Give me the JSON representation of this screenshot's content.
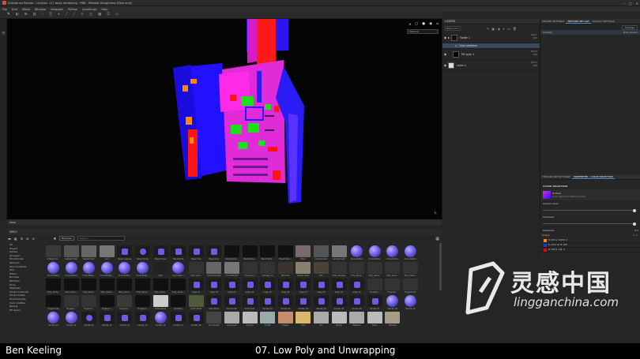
{
  "window": {
    "title": "Substance Painter - License: 117 days remaining - PBR - Metallic Roughness (Real only)",
    "controls": [
      "–",
      "□",
      "×"
    ]
  },
  "menu": [
    "File",
    "Edit",
    "Mode",
    "Window",
    "Viewport",
    "Python",
    "JavaScript",
    "Help"
  ],
  "toolbar": {
    "icons": [
      "paint-icon",
      "eraser-icon",
      "projection-icon",
      "polygon-fill-icon",
      "smudge-icon",
      "clone-icon",
      "picker-icon",
      "brush-icon",
      "line-icon",
      "stamp-icon",
      "mirror-icon",
      "grid-icon",
      "lock-icon",
      "link-icon"
    ]
  },
  "viewport": {
    "mode_dropdown": "Material",
    "controls": [
      "⏸",
      "▢",
      "●",
      "◉",
      "⌂"
    ]
  },
  "layers": {
    "tab_label": "LAYERS",
    "blend_label": "Base Color",
    "items": [
      {
        "name": "Folder 1",
        "blend": "Norm",
        "opacity": "100",
        "type": "folder"
      },
      {
        "name": "Color selection",
        "blend": "",
        "opacity": "",
        "type": "mask"
      },
      {
        "name": "Fill layer 1",
        "blend": "Norm",
        "opacity": "100",
        "type": "fill"
      },
      {
        "name": "Layer 1",
        "blend": "Norm",
        "opacity": "100",
        "type": "paint"
      }
    ]
  },
  "right_panel": {
    "tabs": [
      "SHADER SETTINGS",
      "TEXTURE SET LIST",
      "DISPLAY SETTINGS"
    ],
    "settings_label": "Settings",
    "texture_set": "Console",
    "texture_set_shader": "Main shader",
    "props_tabs": [
      "TEXTURE SET SETTINGS",
      "PROPERTIES - COLOR SELECTION"
    ],
    "section": "COLOR SELECTION",
    "source_title": "ID Mask",
    "source_sub": "Color Map from Mesh Console",
    "output_label": "Output value",
    "hardness_label": "Hardness",
    "tolerance_label": "Tolerance",
    "tolerance_value": "0.1",
    "colors_label": "Colors",
    "colors": [
      {
        "text": "R: 255   G: 138   B: 0",
        "hex": "#ff8a00"
      },
      {
        "text": "R: 24    G: 61    B: 220",
        "hex": "#183ddc"
      },
      {
        "text": "R: 255   G: 0     B: 0",
        "hex": "#ff0000"
      }
    ]
  },
  "bottom_tab": "POSE",
  "shelf": {
    "title": "SHELF",
    "filter": "Textures",
    "search_placeholder": "Search...",
    "categories": [
      "All",
      "Project",
      "Alphas",
      "Grunges",
      "Procedurals",
      "Textures",
      "Hard Surfaces",
      "Skin",
      "Filters",
      "Brushes",
      "Particles",
      "Tools",
      "Materials",
      "Smart materials",
      "Smart masks",
      "Environments",
      "Color profiles",
      "Baking",
      "Fill layers"
    ],
    "tiles": [
      {
        "label": "Ambient Oc...",
        "kind": "noise"
      },
      {
        "label": "Asphalt Fresh",
        "kind": "asphalt"
      },
      {
        "label": "Asphalt Worn",
        "kind": "asphalt2"
      },
      {
        "label": "Soil",
        "kind": "soil"
      },
      {
        "label": "Bevel Capsule",
        "kind": "capsule"
      },
      {
        "label": "Bevel Circle",
        "kind": "ring"
      },
      {
        "label": "Bevel Cross",
        "kind": "cross"
      },
      {
        "label": "Bevel Drop",
        "kind": "drop"
      },
      {
        "label": "Bevel Hex",
        "kind": "hex"
      },
      {
        "label": "Bevel Line",
        "kind": "line"
      },
      {
        "label": "Bevel Perla...",
        "kind": "dark"
      },
      {
        "label": "Bevel Perla...",
        "kind": "dark"
      },
      {
        "label": "Bevel Perla...",
        "kind": "dark"
      },
      {
        "label": "Bevel Perla...",
        "kind": "dark"
      },
      {
        "label": "Brick",
        "kind": "brick"
      },
      {
        "label": "Cement Dark",
        "kind": "cement"
      },
      {
        "label": "Cement Light",
        "kind": "cement2"
      },
      {
        "label": "Circle Button",
        "kind": "sphere"
      },
      {
        "label": "Circle Button",
        "kind": "sphere"
      },
      {
        "label": "Circle Button",
        "kind": "sphere"
      },
      {
        "label": "Circle Button",
        "kind": "sphere"
      },
      {
        "label": "Circle Button",
        "kind": "sphere"
      },
      {
        "label": "Circle Button",
        "kind": "sphere"
      },
      {
        "label": "Circle Butto...",
        "kind": "sphere"
      },
      {
        "label": "Circle Butto...",
        "kind": "sphere"
      },
      {
        "label": "Circle Butto...",
        "kind": "sphere"
      },
      {
        "label": "Circle Butto...",
        "kind": "sphere"
      },
      {
        "label": "Coal",
        "kind": "coal"
      },
      {
        "label": "Color Map 1",
        "kind": "sphere"
      },
      {
        "label": "Color_sam...",
        "kind": "gradient"
      },
      {
        "label": "Concrete Cast",
        "kind": "concrete"
      },
      {
        "label": "Concrete Old",
        "kind": "concrete2"
      },
      {
        "label": "Corrosion 1",
        "kind": "rough"
      },
      {
        "label": "damage_1a",
        "kind": "rough"
      },
      {
        "label": "Dark Soil",
        "kind": "soil2"
      },
      {
        "label": "Desert Sand",
        "kind": "sand"
      },
      {
        "label": "Dirt",
        "kind": "dirt"
      },
      {
        "label": "dirty_damage",
        "kind": "rough"
      },
      {
        "label": "dirty_dama...",
        "kind": "rough"
      },
      {
        "label": "dirty_dama...",
        "kind": "rough"
      },
      {
        "label": "dirty_dama...",
        "kind": "rough"
      },
      {
        "label": "dirty_dama...",
        "kind": "rough"
      },
      {
        "label": "dirty_dama...",
        "kind": "dark"
      },
      {
        "label": "dirty_dama...",
        "kind": "dark"
      },
      {
        "label": "dirty_dama...",
        "kind": "dark"
      },
      {
        "label": "dirty_dama...",
        "kind": "dark"
      },
      {
        "label": "dirty_dama...",
        "kind": "dark"
      },
      {
        "label": "dirty_dama...",
        "kind": "dark"
      },
      {
        "label": "dirty_dama...",
        "kind": "dark"
      },
      {
        "label": "dirty_dama...",
        "kind": "dark"
      },
      {
        "label": "edge_01",
        "kind": "cap"
      },
      {
        "label": "edge_02",
        "kind": "cap"
      },
      {
        "label": "edge_03",
        "kind": "cap"
      },
      {
        "label": "edge_04",
        "kind": "cap"
      },
      {
        "label": "edge_05",
        "kind": "cap"
      },
      {
        "label": "edge_06",
        "kind": "cap"
      },
      {
        "label": "edge_07",
        "kind": "cap"
      },
      {
        "label": "edge_08",
        "kind": "cap"
      },
      {
        "label": "edge_09",
        "kind": "cap"
      },
      {
        "label": "edge_10",
        "kind": "cap"
      },
      {
        "label": "Fingerpri...",
        "kind": "rough"
      },
      {
        "label": "Fingerpri...",
        "kind": "rough"
      },
      {
        "label": "Fingerprints",
        "kind": "rough"
      },
      {
        "label": "Fingerprints",
        "kind": "dark"
      },
      {
        "label": "Fingerpri...",
        "kind": "rough"
      },
      {
        "label": "Fingerpri...",
        "kind": "rough"
      },
      {
        "label": "Fingerpri...",
        "kind": "dark"
      },
      {
        "label": "Fingerpri...",
        "kind": "noise"
      },
      {
        "label": "Fingerpri...",
        "kind": "dark"
      },
      {
        "label": "Fresh Snow",
        "kind": "snow"
      },
      {
        "label": "Gradient",
        "kind": "gradient2"
      },
      {
        "label": "Green Moss",
        "kind": "moss"
      },
      {
        "label": "Grey Mane",
        "kind": "cap"
      },
      {
        "label": "Grid Crown",
        "kind": "cap"
      },
      {
        "label": "Grid Crown",
        "kind": "cap"
      },
      {
        "label": "handle_01",
        "kind": "cap"
      },
      {
        "label": "handle_02",
        "kind": "cap"
      },
      {
        "label": "handle_03",
        "kind": "cap"
      },
      {
        "label": "handle_04",
        "kind": "cap"
      },
      {
        "label": "handle_05",
        "kind": "cap"
      },
      {
        "label": "handle_06",
        "kind": "cap"
      },
      {
        "label": "handle_07",
        "kind": "cap"
      },
      {
        "label": "handle_08",
        "kind": "sphere"
      },
      {
        "label": "handle_09",
        "kind": "sphere"
      },
      {
        "label": "handle_10",
        "kind": "sphere"
      },
      {
        "label": "handle_11",
        "kind": "sphere"
      },
      {
        "label": "handle_12",
        "kind": "ring"
      },
      {
        "label": "handle_13",
        "kind": "hook"
      },
      {
        "label": "handle_14",
        "kind": "cap"
      },
      {
        "label": "handle_15",
        "kind": "cap"
      },
      {
        "label": "handle_16",
        "kind": "sphere"
      },
      {
        "label": "handle_17",
        "kind": "cap"
      },
      {
        "label": "handle_18",
        "kind": "cap"
      },
      {
        "label": "Iron Forged",
        "kind": "iron"
      },
      {
        "label": "Aluminium",
        "kind": "metal"
      },
      {
        "label": "Chrome",
        "kind": "metal2"
      },
      {
        "label": "Cobalt",
        "kind": "cobalt"
      },
      {
        "label": "Copper",
        "kind": "copper"
      },
      {
        "label": "Gold",
        "kind": "gold"
      },
      {
        "label": "Iron",
        "kind": "metal"
      },
      {
        "label": "Nickel",
        "kind": "metal2"
      },
      {
        "label": "Platinum",
        "kind": "metal"
      },
      {
        "label": "Silver",
        "kind": "metal2"
      },
      {
        "label": "Titanium",
        "kind": "titanium"
      }
    ]
  },
  "caption": {
    "author": "Ben Keeling",
    "lesson": "07. Low Poly and Unwrapping"
  },
  "watermark": {
    "cn": "灵感中国",
    "url": "lingganchina.com"
  },
  "colors": {
    "accent": "#3c8be6",
    "model_magenta": "#e12bd8",
    "model_blue": "#1f10ff",
    "model_red": "#ff1414",
    "model_green": "#1de01d",
    "model_orange": "#ff8a00"
  }
}
